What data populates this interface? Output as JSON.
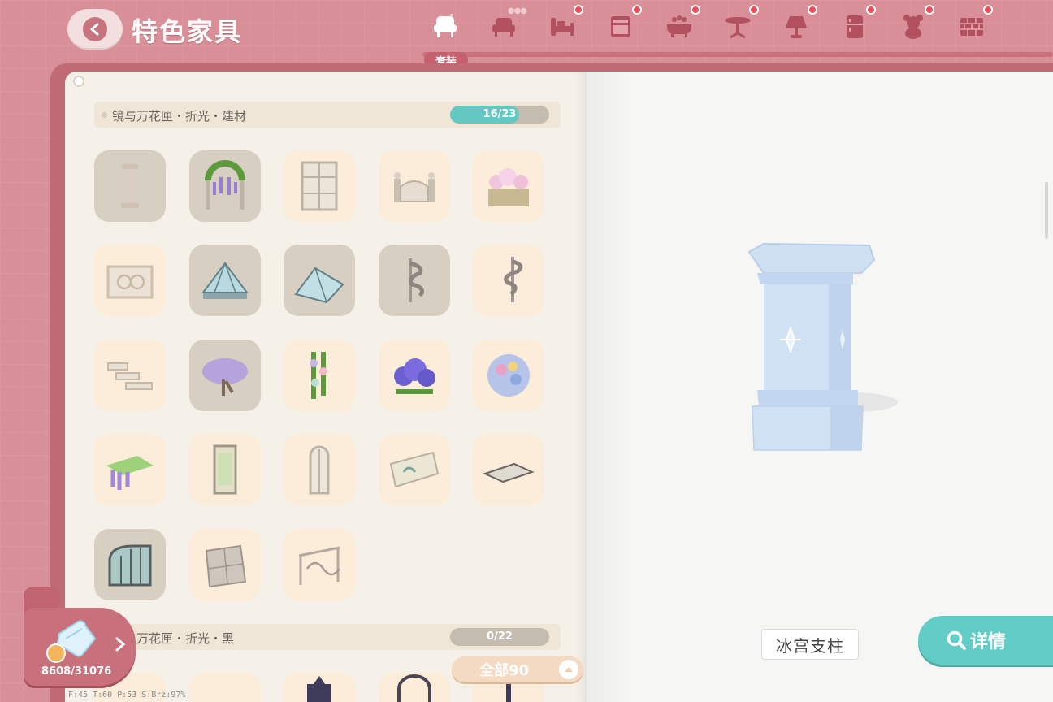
{
  "header": {
    "title": "特色家具",
    "set_badge": "套装"
  },
  "categories": [
    {
      "name": "set",
      "icon": "set-armchair-icon",
      "active": true
    },
    {
      "name": "sofa",
      "icon": "sofa-icon",
      "active": false
    },
    {
      "name": "bed",
      "icon": "bed-icon",
      "active": false
    },
    {
      "name": "cabinet",
      "icon": "cabinet-icon",
      "active": false
    },
    {
      "name": "bathtub",
      "icon": "bathtub-icon",
      "active": false
    },
    {
      "name": "table",
      "icon": "table-icon",
      "active": false
    },
    {
      "name": "lamp",
      "icon": "lamp-icon",
      "active": false
    },
    {
      "name": "fridge",
      "icon": "fridge-icon",
      "active": false
    },
    {
      "name": "teddy",
      "icon": "teddy-bear-icon",
      "active": false
    },
    {
      "name": "wall",
      "icon": "brick-wall-icon",
      "active": false
    }
  ],
  "sections": [
    {
      "name": "镜与万花匣・折光・建材",
      "progress": "16/23",
      "collected": 16,
      "total": 23
    },
    {
      "name": "镜与万花匣・折光・黑",
      "progress": "0/22",
      "collected": 0,
      "total": 22
    }
  ],
  "items": [
    {
      "icon": "column-icon",
      "owned": false
    },
    {
      "icon": "wisteria-arch-icon",
      "owned": false
    },
    {
      "icon": "window-icon",
      "owned": true
    },
    {
      "icon": "gate-icon",
      "owned": true
    },
    {
      "icon": "flower-planter-icon",
      "owned": true
    },
    {
      "icon": "carved-railing-icon",
      "owned": true
    },
    {
      "icon": "glass-roof-icon",
      "owned": false
    },
    {
      "icon": "glass-roof-small-icon",
      "owned": false
    },
    {
      "icon": "spiral-stair-icon",
      "owned": false
    },
    {
      "icon": "spiral-stair-alt-icon",
      "owned": true
    },
    {
      "icon": "stone-steps-icon",
      "owned": true
    },
    {
      "icon": "wisteria-tree-icon",
      "owned": false
    },
    {
      "icon": "hanging-flowers-icon",
      "owned": true
    },
    {
      "icon": "hyacinth-bush-icon",
      "owned": true
    },
    {
      "icon": "hydrangea-icon",
      "owned": true
    },
    {
      "icon": "flower-platform-icon",
      "owned": true
    },
    {
      "icon": "stained-glass-door-icon",
      "owned": true
    },
    {
      "icon": "tall-window-icon",
      "owned": true
    },
    {
      "icon": "wall-panel-icon",
      "owned": true
    },
    {
      "icon": "floor-tile-icon",
      "owned": true
    },
    {
      "icon": "greenhouse-icon",
      "owned": false
    },
    {
      "icon": "stone-floor-icon",
      "owned": true
    },
    {
      "icon": "iron-railing-icon",
      "owned": true
    }
  ],
  "preview": {
    "item_name": "冰宫支柱"
  },
  "detail_button": "详情",
  "puzzle": {
    "count": "8608/31076"
  },
  "filter": {
    "all_label": "全部90"
  },
  "debug": "F:45  T:60  P:53  S:Brz:97%"
}
